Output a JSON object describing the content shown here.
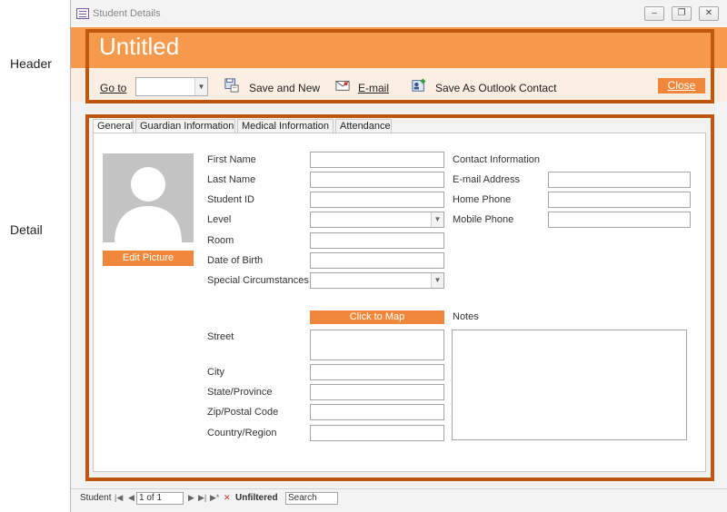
{
  "annotations": {
    "header": "Header",
    "detail": "Detail"
  },
  "window": {
    "title": "Student Details",
    "minimize_glyph": "–",
    "restore_glyph": "❐",
    "close_glyph": "✕"
  },
  "header": {
    "form_title": "Untitled",
    "goto_label": "Go to",
    "goto_value": "",
    "save_new_label": "Save and New",
    "email_label": "E-mail",
    "save_outlook_label": "Save As Outlook Contact",
    "close_label": "Close"
  },
  "tabs": [
    "General",
    "Guardian Information",
    "Medical Information",
    "Attendance"
  ],
  "general": {
    "edit_picture": "Edit Picture",
    "labels": {
      "first_name": "First Name",
      "last_name": "Last Name",
      "student_id": "Student ID",
      "level": "Level",
      "room": "Room",
      "date_of_birth": "Date of Birth",
      "special_circumstances": "Special Circumstances",
      "contact_information": "Contact Information",
      "email_address": "E-mail Address",
      "home_phone": "Home Phone",
      "mobile_phone": "Mobile Phone",
      "street": "Street",
      "city": "City",
      "state_province": "State/Province",
      "zip_postal": "Zip/Postal Code",
      "country_region": "Country/Region",
      "notes": "Notes"
    },
    "click_to_map": "Click to Map"
  },
  "status_bar": {
    "record_label": "Student",
    "record_position": "1 of 1",
    "filter_label": "Unfiltered",
    "search_placeholder": "Search"
  },
  "colors": {
    "accent": "#f59a4c",
    "button": "#f0873a",
    "outline": "#c0570e",
    "header_bg": "#fbeee2"
  }
}
